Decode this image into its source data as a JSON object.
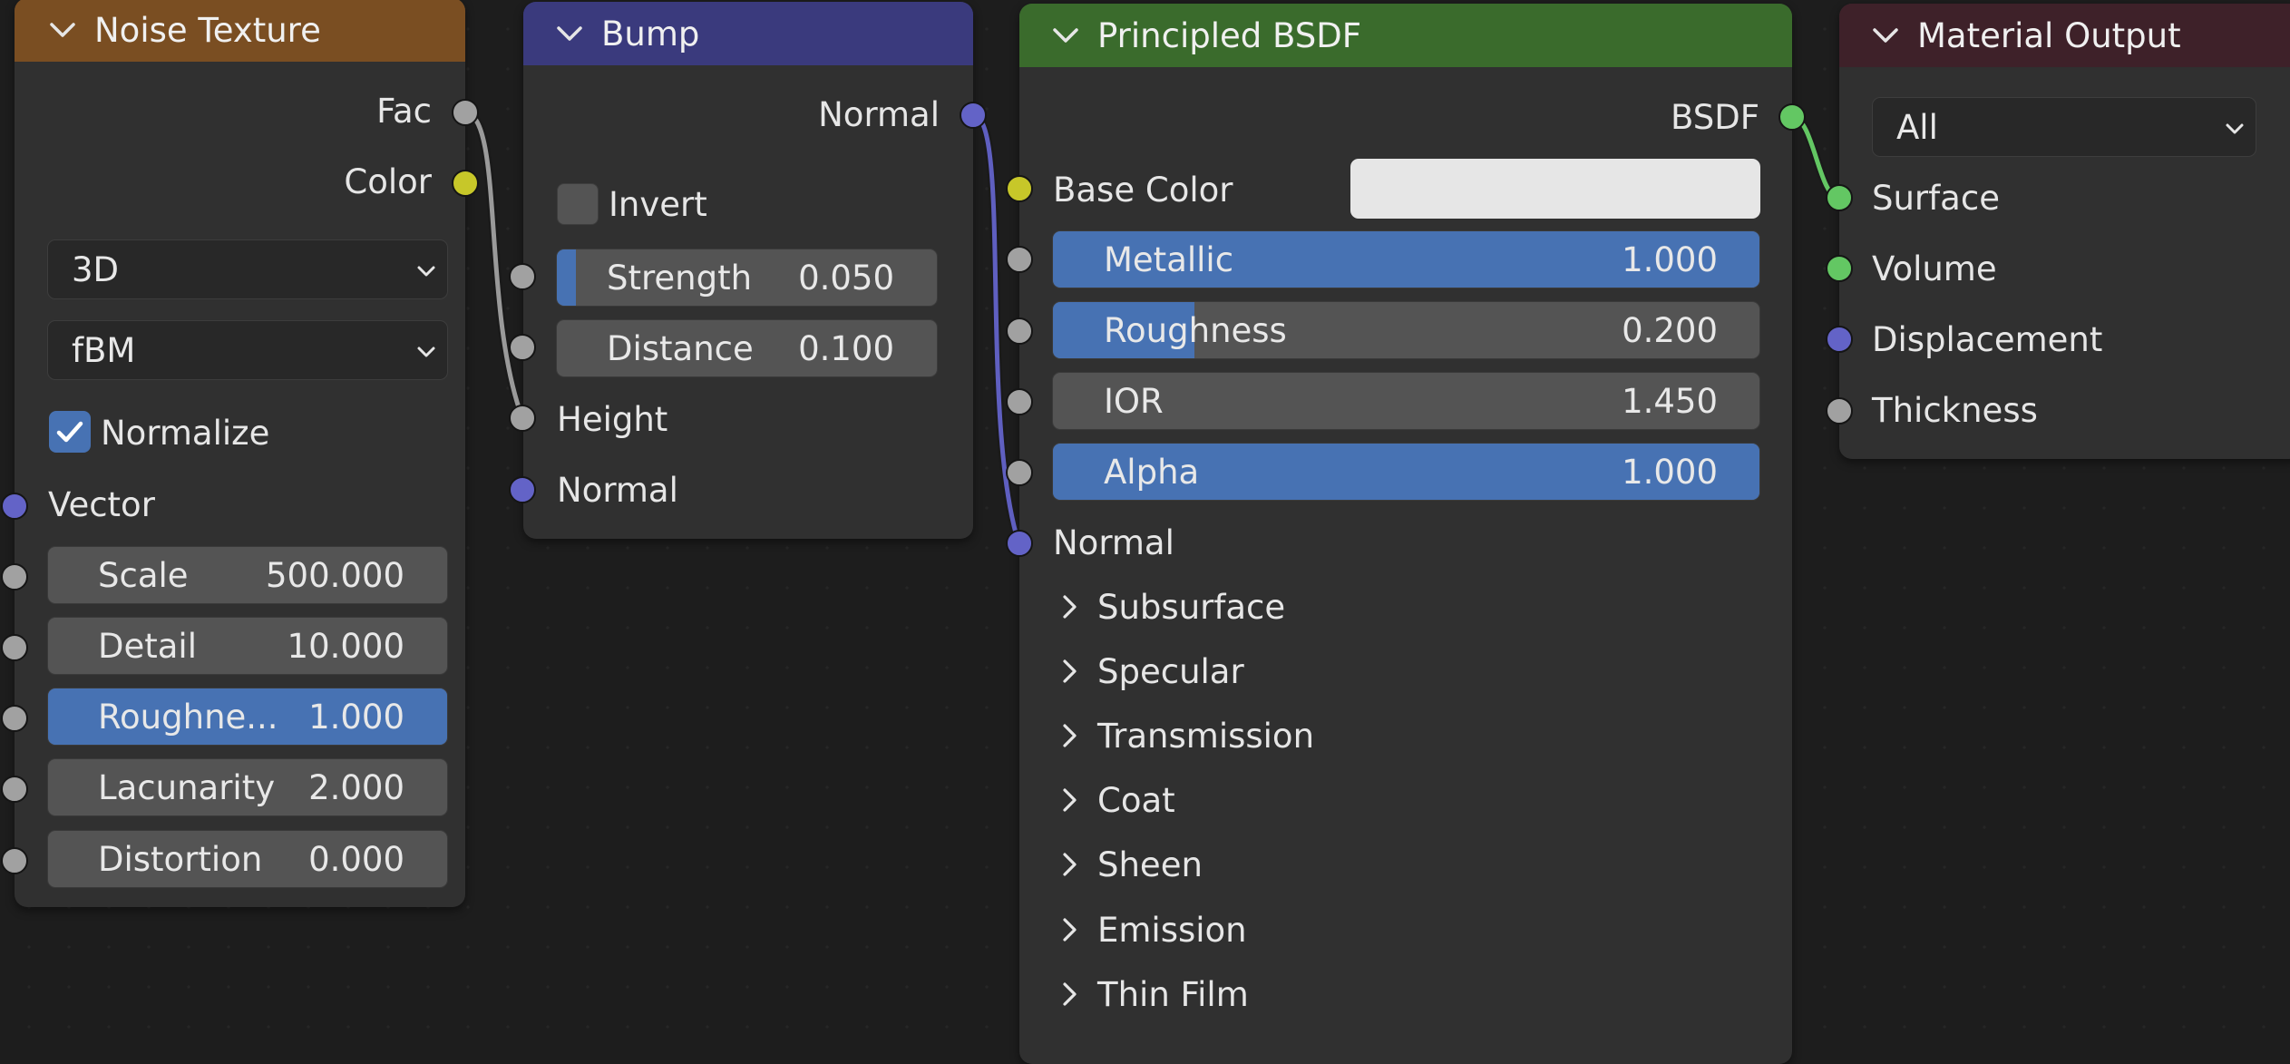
{
  "colors": {
    "noise_header": "#7a4e22",
    "bump_header": "#3a3a7d",
    "bsdf_header": "#3a6b2c",
    "output_header": "#3e2129",
    "field_bg": "#545454",
    "field_active": "#4772b3",
    "base_color": "#e6e6e6"
  },
  "noise": {
    "title": "Noise Texture",
    "out_fac": "Fac",
    "out_color": "Color",
    "dimensions": "3D",
    "type": "fBM",
    "normalize_label": "Normalize",
    "normalize_checked": true,
    "vector_label": "Vector",
    "scale_label": "Scale",
    "scale_value": "500.000",
    "detail_label": "Detail",
    "detail_value": "10.000",
    "roughness_label": "Roughne...",
    "roughness_value": "1.000",
    "roughness_fraction": 1.0,
    "lacunarity_label": "Lacunarity",
    "lacunarity_value": "2.000",
    "distortion_label": "Distortion",
    "distortion_value": "0.000"
  },
  "bump": {
    "title": "Bump",
    "out_normal": "Normal",
    "invert_label": "Invert",
    "invert_checked": false,
    "strength_label": "Strength",
    "strength_value": "0.050",
    "strength_fraction": 0.05,
    "distance_label": "Distance",
    "distance_value": "0.100",
    "height_label": "Height",
    "normal_label": "Normal"
  },
  "bsdf": {
    "title": "Principled BSDF",
    "out_bsdf": "BSDF",
    "base_color_label": "Base Color",
    "metallic_label": "Metallic",
    "metallic_value": "1.000",
    "metallic_fraction": 1.0,
    "roughness_label": "Roughness",
    "roughness_value": "0.200",
    "roughness_fraction": 0.2,
    "ior_label": "IOR",
    "ior_value": "1.450",
    "alpha_label": "Alpha",
    "alpha_value": "1.000",
    "alpha_fraction": 1.0,
    "normal_label": "Normal",
    "panels": [
      "Subsurface",
      "Specular",
      "Transmission",
      "Coat",
      "Sheen",
      "Emission",
      "Thin Film"
    ]
  },
  "output": {
    "title": "Material Output",
    "target": "All",
    "surface_label": "Surface",
    "volume_label": "Volume",
    "displacement_label": "Displacement",
    "thickness_label": "Thickness"
  }
}
